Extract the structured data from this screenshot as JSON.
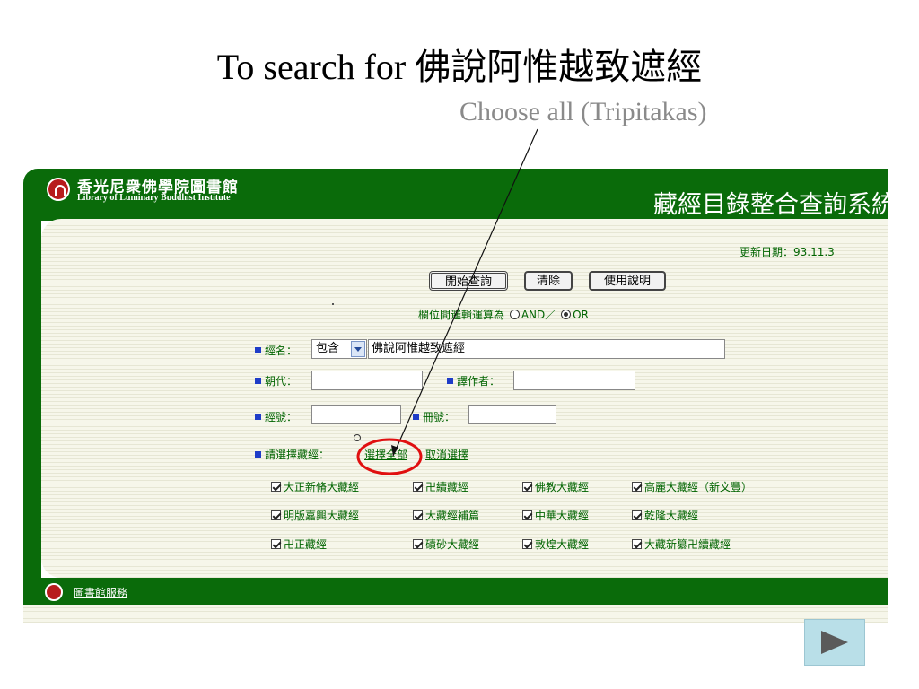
{
  "slide": {
    "title": "To search for 佛說阿惟越致遮經",
    "annotation": "Choose all (Tripitakas)"
  },
  "header": {
    "library_name_cn": "香光尼衆佛學院圖書館",
    "library_name_en": "Library of Luminary Buddhist Institute",
    "system_title": "藏經目錄整合查詢系統"
  },
  "form": {
    "update_date": "更新日期：93.11.3",
    "buttons": {
      "search": "開始查詢",
      "clear": "清除",
      "help": "使用說明"
    },
    "logic_label": "欄位間邏輯運算為",
    "logic_and": "AND／",
    "logic_or": "OR",
    "logic_selected": "OR",
    "sutra_name_label": "經名：",
    "match_mode": "包含",
    "sutra_name_value": "佛說阿惟越致遮經",
    "dynasty_label": "朝代：",
    "dynasty_value": "",
    "translator_label": "譯作者：",
    "translator_value": "",
    "sutra_no_label": "經號：",
    "sutra_no_value": "",
    "volume_label": "冊號：",
    "volume_value": "",
    "choose_canon_label": "請選擇藏經：",
    "select_all": "選擇全部",
    "deselect": "取消選擇"
  },
  "canons": [
    [
      "大正新脩大藏經",
      "卍續藏經",
      "佛教大藏經",
      "高麗大藏經（新文豐）"
    ],
    [
      "明版嘉興大藏經",
      "大藏經補篇",
      "中華大藏經",
      "乾隆大藏經"
    ],
    [
      "卍正藏經",
      "磧砂大藏經",
      "敦煌大藏經",
      "大藏新纂卍續藏經"
    ]
  ],
  "footer": {
    "service_link": "圖書館服務"
  },
  "colors": {
    "brand_green": "#0a6b0a",
    "highlight_red": "#e01010",
    "label_green": "#006400"
  },
  "icons": {
    "logo": "library-logo-icon",
    "next": "next-arrow-icon"
  }
}
